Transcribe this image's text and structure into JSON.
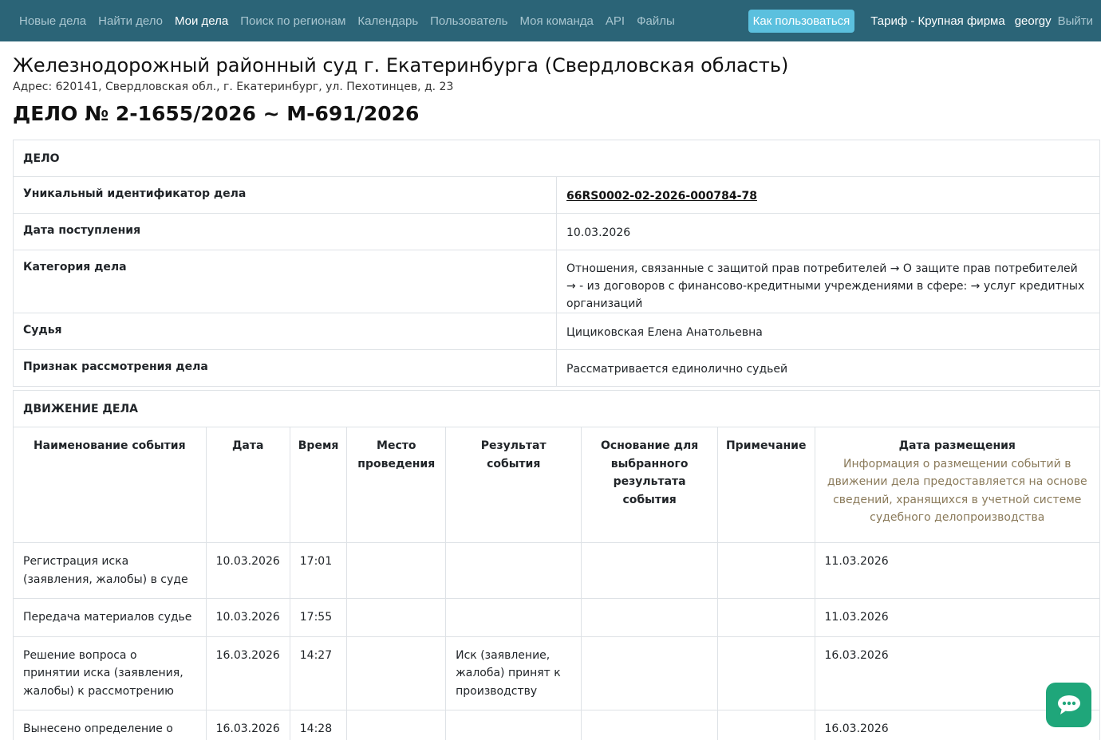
{
  "nav": {
    "links": [
      "Новые дела",
      "Найти дело",
      "Мои дела",
      "Поиск по регионам",
      "Календарь",
      "Пользователь",
      "Моя команда",
      "API",
      "Файлы"
    ],
    "active": "Мои дела",
    "help_label": "Как пользоваться",
    "tariff": "Тариф - Крупная фирма",
    "user": "georgy",
    "logout": "Выйти"
  },
  "court": {
    "title": "Железнодорожный районный суд г. Екатеринбурга (Свердловская область)",
    "address": "Адрес: 620141, Свердловская обл., г. Екатеринбург, ул. Пехотинцев, д. 23"
  },
  "case": {
    "title": "ДЕЛО № 2-1655/2026 ~ М-691/2026",
    "section_title": "ДЕЛО",
    "rows": [
      {
        "label": "Уникальный идентификатор дела",
        "value": "66RS0002-02-2026-000784-78"
      },
      {
        "label": "Дата поступления",
        "value": "10.03.2026"
      },
      {
        "label": "Категория дела",
        "value": "Отношения, связанные с защитой прав потребителей → О защите прав потребителей → - из договоров с финансово-кредитными учреждениями в сфере: → услуг кредитных организаций"
      },
      {
        "label": "Судья",
        "value": "Цициковская Елена Анатольевна"
      },
      {
        "label": "Признак рассмотрения дела",
        "value": "Рассматривается единолично судьей"
      }
    ]
  },
  "movement": {
    "section_title": "ДВИЖЕНИЕ ДЕЛА",
    "columns": [
      "Наименование события",
      "Дата",
      "Время",
      "Место проведения",
      "Результат события",
      "Основание для выбранного результата события",
      "Примечание",
      "Дата размещения"
    ],
    "posting_note": "Информация о размещении событий в движении дела предоставляется на основе сведений, хранящихся в учетной системе судебного делопроизводства",
    "rows": [
      [
        "Регистрация иска (заявления, жалобы) в суде",
        "10.03.2026",
        "17:01",
        "",
        "",
        "",
        "",
        "11.03.2026"
      ],
      [
        "Передача материалов судье",
        "10.03.2026",
        "17:55",
        "",
        "",
        "",
        "",
        "11.03.2026"
      ],
      [
        "Решение вопроса о принятии иска (заявления, жалобы) к рассмотрению",
        "16.03.2026",
        "14:27",
        "",
        "Иск (заявление, жалоба) принят к производству",
        "",
        "",
        "16.03.2026"
      ],
      [
        "Вынесено определение о",
        "16.03.2026",
        "14:28",
        "",
        "",
        "",
        "",
        "16.03.2026"
      ]
    ]
  },
  "icons": {
    "chat": "chat-bubble-icon"
  },
  "colors": {
    "navbar": "#2b6477",
    "help_button": "#5bc0de",
    "chat_button": "#1fa67a"
  }
}
